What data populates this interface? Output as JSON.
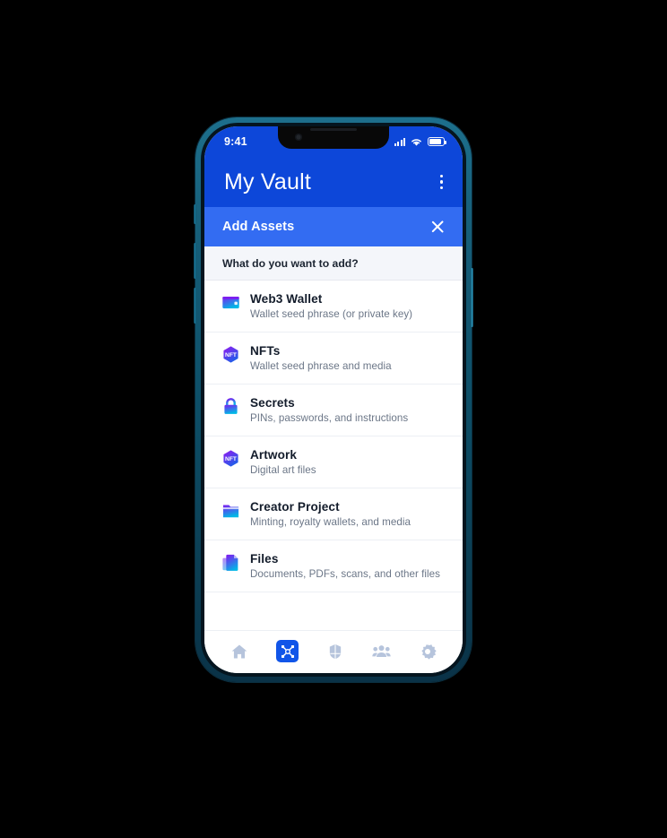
{
  "device": {
    "frame_color": "#0d4f68",
    "status_bar": {
      "time": "9:41",
      "signal_icon": "cellular-bars-icon",
      "wifi_icon": "wifi-icon",
      "battery_icon": "battery-icon"
    }
  },
  "app_bar": {
    "title": "My Vault",
    "background": "#0d47d9",
    "menu_icon": "kebab-menu-icon"
  },
  "sub_header": {
    "title": "Add Assets",
    "background": "#336cf2",
    "close_icon": "close-icon"
  },
  "prompt": {
    "text": "What do you want to add?"
  },
  "asset_options": [
    {
      "title": "Web3 Wallet",
      "subtitle": "Wallet seed phrase (or private key)",
      "icon": "wallet-icon"
    },
    {
      "title": "NFTs",
      "subtitle": "Wallet seed phrase and media",
      "icon": "nft-hexagon-icon"
    },
    {
      "title": "Secrets",
      "subtitle": "PINs, passwords, and instructions",
      "icon": "lock-icon"
    },
    {
      "title": "Artwork",
      "subtitle": "Digital art files",
      "icon": "nft-hexagon-icon"
    },
    {
      "title": "Creator Project",
      "subtitle": "Minting, royalty wallets, and media",
      "icon": "folder-icon"
    },
    {
      "title": "Files",
      "subtitle": "Documents, PDFs, scans, and other files",
      "icon": "documents-stack-icon"
    }
  ],
  "bottom_nav": {
    "items": [
      {
        "icon": "home-icon",
        "active": false
      },
      {
        "icon": "vault-icon",
        "active": true
      },
      {
        "icon": "shield-helmet-icon",
        "active": false
      },
      {
        "icon": "people-icon",
        "active": false
      },
      {
        "icon": "gear-icon",
        "active": false
      }
    ],
    "active_background": "#1155e8",
    "inactive_color": "#b6c4dc"
  },
  "accent_colors": {
    "primary_blue": "#0d47d9",
    "secondary_blue": "#336cf2",
    "icon_gradient_start": "#7b1ff0",
    "icon_gradient_end": "#00b8e6"
  }
}
